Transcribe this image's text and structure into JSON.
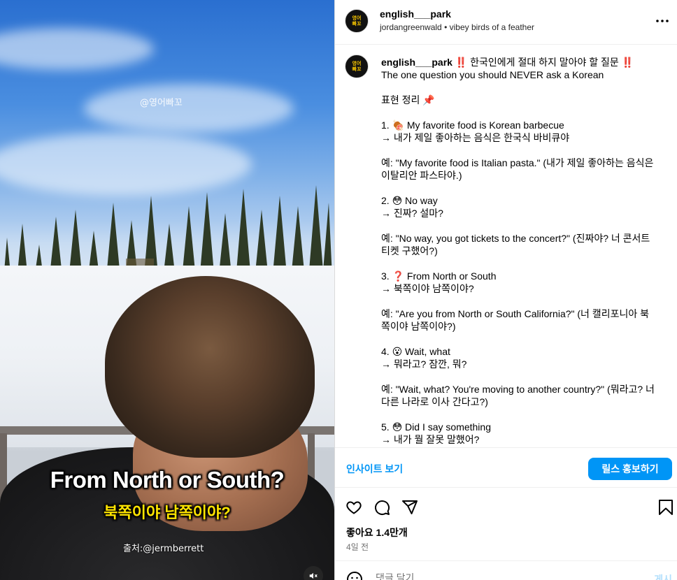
{
  "media": {
    "watermark": "@영어빠꼬",
    "caption_en": "From North or South?",
    "caption_ko": "북쪽이야 남쪽이야?",
    "source_credit": "출처:@jermberrett"
  },
  "header": {
    "avatar_text_line1": "영어",
    "avatar_text_line2": "빠꼬",
    "username": "english___park",
    "audio_credit": "jordangreenwald • vibey birds of a feather"
  },
  "post": {
    "username": "english___park",
    "lines": [
      "‼️ 한국인에게 절대 하지 말아야 할 질문 ‼️",
      "The one question you should NEVER ask a Korean",
      "",
      "표현 정리 📌",
      "",
      "1. 🍖 My favorite food is Korean barbecue",
      "→ 내가 제일 좋아하는 음식은 한국식 바비큐야",
      "",
      "예: \"My favorite food is Italian pasta.\" (내가 제일 좋아하는 음식은",
      "이탈리안 파스타야.)",
      "",
      "2. 😳 No way",
      "→ 진짜? 설마?",
      "",
      "예: \"No way, you got tickets to the concert?\" (진짜야? 너 콘서트",
      "티켓 구했어?)",
      "",
      "3. ❓ From North or South",
      "→ 북쪽이야 남쪽이야?",
      "",
      "예: \"Are you from North or South California?\" (너 캘리포니아 북",
      "쪽이야 남쪽이야?)",
      "",
      "4. 😮 Wait, what",
      "→ 뭐라고? 잠깐, 뭐?",
      "",
      "예: \"Wait, what? You're moving to another country?\" (뭐라고? 너",
      "다른 나라로 이사 간다고?)",
      "",
      "5. 😳 Did I say something",
      "→ 내가 뭘 잘못 말했어?"
    ]
  },
  "insight": {
    "link_label": "인사이트 보기",
    "boost_label": "릴스 홍보하기"
  },
  "stats": {
    "likes": "좋아요 1.4만개",
    "date": "4일 전"
  },
  "comment": {
    "placeholder": "댓글 달기...",
    "post_label": "게시"
  },
  "colors": {
    "accent": "#0095f6",
    "caption_yellow": "#ffe500"
  }
}
